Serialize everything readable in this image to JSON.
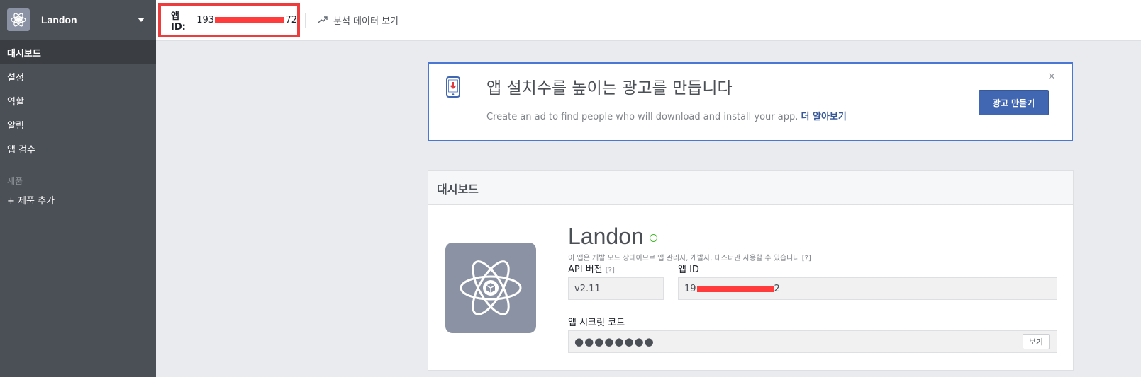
{
  "sidebar": {
    "app_name": "Landon",
    "items": [
      {
        "label": "대시보드"
      },
      {
        "label": "설정"
      },
      {
        "label": "역할"
      },
      {
        "label": "알림"
      },
      {
        "label": "앱 검수"
      }
    ],
    "section_label": "제품",
    "add_product": "+ 제품 추가"
  },
  "topbar": {
    "app_id_label": "앱 ID:",
    "app_id_prefix": "193",
    "app_id_suffix": "72",
    "analytics_label": "분석 데이터 보기"
  },
  "ad_card": {
    "title": "앱 설치수를 높이는 광고를 만듭니다",
    "description": "Create an ad to find people who will download and install your app.",
    "learn_more": "더 알아보기",
    "close": "×",
    "button_label": "광고 만들기"
  },
  "dashboard": {
    "heading": "대시보드",
    "app_name": "Landon",
    "dev_note": "이 앱은 개발 모드 상태이므로 앱 관리자, 개발자, 테스터만 사용할 수 있습니다 [?]",
    "api_version_label": "API 버전",
    "api_version_help": "[?]",
    "api_version_value": "v2.11",
    "app_id_label": "앱 ID",
    "app_id_prefix": "19",
    "app_id_suffix": "2",
    "secret_label": "앱 시크릿 코드",
    "secret_value": "●●●●●●●●",
    "show_button": "보기"
  },
  "colors": {
    "sidebar_bg": "#4b4f56",
    "accent": "#4267b2",
    "highlight": "#ee3b3b",
    "status_green": "#42b72a"
  }
}
